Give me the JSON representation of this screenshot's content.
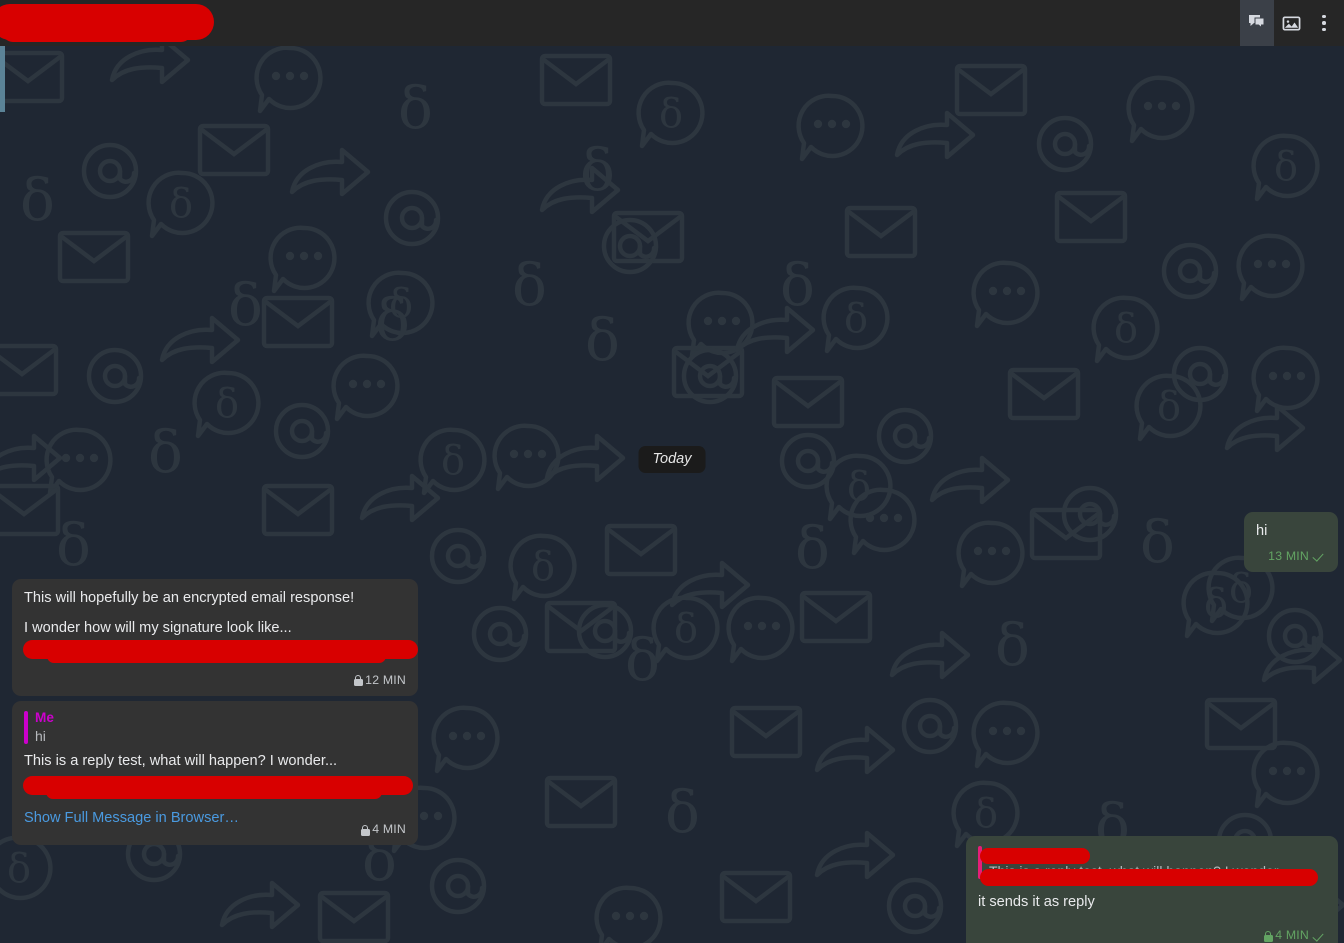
{
  "header": {
    "title_redacted": true,
    "actions": [
      {
        "name": "messages-icon",
        "label": "Messages"
      },
      {
        "name": "gallery-icon",
        "label": "Gallery"
      },
      {
        "name": "more-menu-icon",
        "label": "More options"
      }
    ]
  },
  "chat": {
    "date_divider": "Today",
    "messages": [
      {
        "id": "hi-out",
        "direction": "outgoing",
        "text": "hi",
        "time": "13 MIN",
        "encrypted": false,
        "delivered": true
      },
      {
        "id": "encrypted-email",
        "direction": "incoming",
        "line1": "This will hopefully be an encrypted email response!",
        "line2": "I wonder how will my signature look like...",
        "redacted_signature": true,
        "time": "12 MIN",
        "encrypted": true
      },
      {
        "id": "reply-test",
        "direction": "incoming",
        "quote_author": "Me",
        "quote_text": "hi",
        "text": "This is a reply test, what will happen? I wonder...",
        "redacted_signature": true,
        "link": "Show Full Message in Browser…",
        "time": "4 MIN",
        "encrypted": true
      },
      {
        "id": "sends-as-reply",
        "direction": "outgoing",
        "quote_author_redacted": true,
        "quote_text": "This is a reply test, what will happen? I wonder...",
        "text": "it sends it as reply",
        "time": "4 MIN",
        "encrypted": true,
        "delivered": true
      }
    ]
  },
  "colors": {
    "background": "#1f2733",
    "pattern": "#2e3640",
    "header_bg": "#262626",
    "incoming_bubble": "#333333",
    "outgoing_bubble": "#39453c",
    "quote_bar_incoming": "#cc00cc",
    "quote_bar_outgoing": "#e61e78",
    "link": "#4a9ae0",
    "meta_green": "#63a463",
    "redaction": "#d80000",
    "edge_strip": "#5b8397"
  }
}
